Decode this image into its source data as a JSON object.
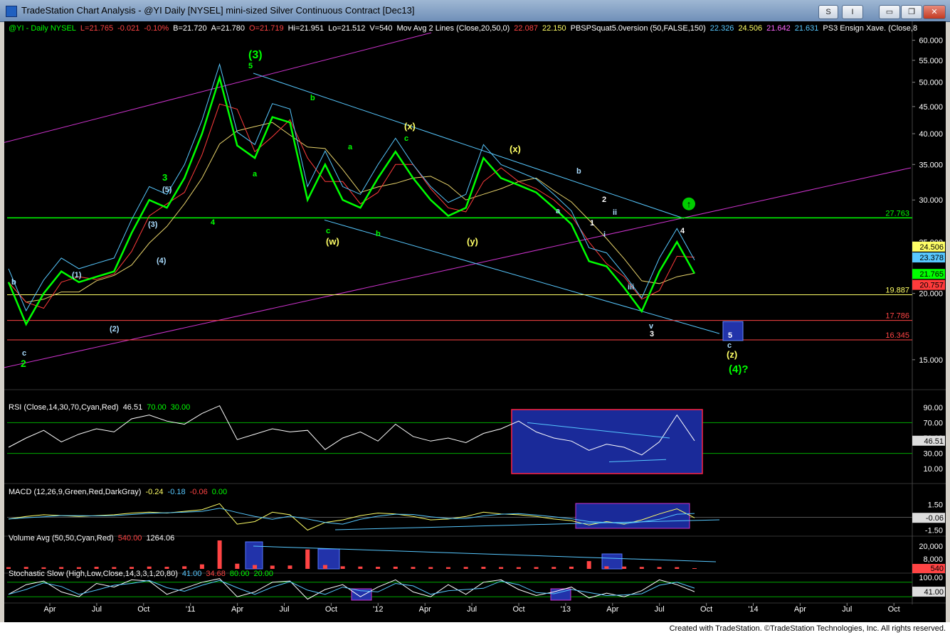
{
  "window": {
    "title": "TradeStation Chart Analysis - @YI Daily [NYSEL] mini-sized Silver Continuous Contract [Dec13]",
    "buttons": {
      "s_label": "S",
      "i_label": "I",
      "minimize": "▭",
      "restore": "❐",
      "close": "✕"
    }
  },
  "footer": {
    "text": "Created with TradeStation. ©TradeStation Technologies, Inc. All rights reserved."
  },
  "colors": {
    "price_up": "#00ff00",
    "ma20": "#ff3b3b",
    "ma50": "#e6d26a",
    "channel": "#57c8ff",
    "magenta": "#cc33cc",
    "resistance": "#00ff00",
    "support_yellow": "#ffff66",
    "support_red": "#ff4444"
  },
  "panels": {
    "price": {
      "header": [
        {
          "text": "@YI - Daily  NYSEL",
          "color": "#00ff00"
        },
        {
          "text": "L=21.765",
          "color": "#ff4444"
        },
        {
          "text": "-0.021",
          "color": "#ff4444"
        },
        {
          "text": "-0.10%",
          "color": "#ff4444"
        },
        {
          "text": "B=21.720",
          "color": "#ffffff"
        },
        {
          "text": "A=21.780",
          "color": "#ffffff"
        },
        {
          "text": "O=21.719",
          "color": "#ff4444"
        },
        {
          "text": "Hi=21.951",
          "color": "#ffffff"
        },
        {
          "text": "Lo=21.512",
          "color": "#ffffff"
        },
        {
          "text": "V=540",
          "color": "#ffffff"
        },
        {
          "text": "Mov Avg 2 Lines (Close,20,50,0)",
          "color": "#ffffff"
        },
        {
          "text": "22.087",
          "color": "#ff4444"
        },
        {
          "text": "22.150",
          "color": "#ffff66"
        },
        {
          "text": "PBSPSquat5.0version (50,FALSE,150)",
          "color": "#ffffff"
        },
        {
          "text": "22.326",
          "color": "#57c8ff"
        },
        {
          "text": "24.506",
          "color": "#ffff66"
        },
        {
          "text": "21.642",
          "color": "#ff66ff"
        },
        {
          "text": "21.631",
          "color": "#57c8ff"
        },
        {
          "text": "PS3 Ensign Xave. (Close,8",
          "color": "#ffffff"
        }
      ]
    },
    "rsi": {
      "header": [
        {
          "text": "RSI (Close,14,30,70,Cyan,Red)",
          "color": "#ffffff"
        },
        {
          "text": "46.51",
          "color": "#ffffff"
        },
        {
          "text": "70.00",
          "color": "#00ff00"
        },
        {
          "text": "30.00",
          "color": "#00ff00"
        }
      ]
    },
    "macd": {
      "header": [
        {
          "text": "MACD (12,26,9,Green,Red,DarkGray)",
          "color": "#ffffff"
        },
        {
          "text": "-0.24",
          "color": "#ffff66"
        },
        {
          "text": "-0.18",
          "color": "#57c8ff"
        },
        {
          "text": "-0.06",
          "color": "#ff4444"
        },
        {
          "text": "0.00",
          "color": "#00ff00"
        }
      ]
    },
    "volume": {
      "header": [
        {
          "text": "Volume Avg (50,50,Cyan,Red)",
          "color": "#ffffff"
        },
        {
          "text": "540.00",
          "color": "#ff4444"
        },
        {
          "text": "1264.06",
          "color": "#ffffff"
        }
      ]
    },
    "stoch": {
      "header": [
        {
          "text": "Stochastic Slow (High,Low,Close,14,3,3,1,20,80)",
          "color": "#ffffff"
        },
        {
          "text": "41.00",
          "color": "#57c8ff"
        },
        {
          "text": "34.68",
          "color": "#ff4444"
        },
        {
          "text": "80.00",
          "color": "#00ff00"
        },
        {
          "text": "20.00",
          "color": "#00ff00"
        }
      ]
    }
  },
  "chart_data": [
    {
      "type": "line",
      "x_tick_labels": [
        "Apr",
        "Jul",
        "Oct",
        "'11",
        "Apr",
        "Jul",
        "Oct",
        "'12",
        "Apr",
        "Jul",
        "Oct",
        "'13",
        "Apr",
        "Jul",
        "Oct",
        "'14",
        "Apr",
        "Jul",
        "Oct"
      ],
      "ylim": [
        13.5,
        62
      ],
      "y_scale": "log",
      "y_ticks": [
        "60.000",
        "55.000",
        "50.000",
        "45.000",
        "40.000",
        "35.000",
        "30.000",
        "25.000",
        "20.000",
        "15.000"
      ],
      "series": [
        {
          "values": [
            21.0,
            17.5,
            20.0,
            22.0,
            21.0,
            21.5,
            22.0,
            26.0,
            30.0,
            29.0,
            33.0,
            40.0,
            51.0,
            38.0,
            36.0,
            43.0,
            42.0,
            30.0,
            35.0,
            30.0,
            29.0,
            33.0,
            37.0,
            33.0,
            30.0,
            28.0,
            29.0,
            36.0,
            33.0,
            32.0,
            31.0,
            29.0,
            27.0,
            23.0,
            22.5,
            20.5,
            18.5,
            22.0,
            25.0,
            21.8
          ]
        }
      ],
      "horizontal_levels": [
        {
          "value": 27.763,
          "label": "27.763"
        },
        {
          "value": 19.887,
          "label": "19.887"
        },
        {
          "value": 17.786,
          "label": "17.786"
        },
        {
          "value": 16.345,
          "label": "16.345"
        }
      ],
      "right_badges": [
        {
          "label": "24.506"
        },
        {
          "label": "23.378"
        },
        {
          "label": "21.765"
        },
        {
          "label": "20.757"
        }
      ],
      "wave_labels": [
        {
          "text": "(3)",
          "color": "#00ff00"
        },
        {
          "text": "5",
          "color": "#00ff00"
        },
        {
          "text": "3",
          "color": "#00ff00"
        },
        {
          "text": "(5)",
          "color": "#aaddff"
        },
        {
          "text": "(3)",
          "color": "#aaddff"
        },
        {
          "text": "(4)",
          "color": "#aaddff"
        },
        {
          "text": "4",
          "color": "#00ff00"
        },
        {
          "text": "(1)",
          "color": "#aaddff"
        },
        {
          "text": "(2)",
          "color": "#aaddff"
        },
        {
          "text": "b",
          "color": "#aaddff"
        },
        {
          "text": "c",
          "color": "#aaddff"
        },
        {
          "text": "2",
          "color": "#00ff00"
        },
        {
          "text": "a",
          "color": "#00ff00"
        },
        {
          "text": "b",
          "color": "#00ff00"
        },
        {
          "text": "a",
          "color": "#00ff00"
        },
        {
          "text": "c",
          "color": "#00ff00"
        },
        {
          "text": "(w)",
          "color": "#ffff66"
        },
        {
          "text": "b",
          "color": "#00ff00"
        },
        {
          "text": "(x)",
          "color": "#ffff66"
        },
        {
          "text": "c",
          "color": "#00ff00"
        },
        {
          "text": "(y)",
          "color": "#ffff66"
        },
        {
          "text": "(x)",
          "color": "#ffff66"
        },
        {
          "text": "b",
          "color": "#aaddff"
        },
        {
          "text": "a",
          "color": "#aaddff"
        },
        {
          "text": "1",
          "color": "#ffffff"
        },
        {
          "text": "2",
          "color": "#ffffff"
        },
        {
          "text": "i",
          "color": "#aaddff"
        },
        {
          "text": "ii",
          "color": "#aaddff"
        },
        {
          "text": "iii",
          "color": "#aaddff"
        },
        {
          "text": "4",
          "color": "#ffffff"
        },
        {
          "text": "v",
          "color": "#aaddff"
        },
        {
          "text": "3",
          "color": "#ffffff"
        },
        {
          "text": "5",
          "color": "#ffffff"
        },
        {
          "text": "c",
          "color": "#aaddff"
        },
        {
          "text": "(z)",
          "color": "#ffff66"
        },
        {
          "text": "(4)?",
          "color": "#00ff00"
        }
      ]
    },
    {
      "type": "line",
      "ylim": [
        0,
        100
      ],
      "y_ticks": [
        "90.00",
        "70.00",
        "50.00",
        "30.00",
        "10.00"
      ],
      "levels": [
        70,
        30
      ],
      "series": [
        {
          "values": [
            38,
            50,
            60,
            45,
            55,
            62,
            58,
            75,
            80,
            72,
            68,
            82,
            92,
            48,
            55,
            62,
            58,
            60,
            35,
            50,
            58,
            46,
            68,
            52,
            46,
            50,
            44,
            56,
            62,
            72,
            58,
            50,
            46,
            34,
            42,
            38,
            28,
            45,
            80,
            46.51
          ]
        }
      ]
    },
    {
      "type": "line",
      "y_ticks": [
        "1.50",
        "-1.50"
      ],
      "series": [
        {
          "values": [
            -0.2,
            0.1,
            0.3,
            0.2,
            0.1,
            0.2,
            0.3,
            0.5,
            0.6,
            0.5,
            0.7,
            0.9,
            1.6,
            -0.8,
            -0.5,
            0.6,
            0.3,
            -1.5,
            -0.6,
            -0.3,
            0.2,
            0.5,
            0.4,
            0.1,
            -0.3,
            -0.2,
            0.1,
            0.6,
            0.4,
            0.3,
            0.1,
            -0.2,
            -0.4,
            -0.9,
            -0.5,
            -0.8,
            -0.3,
            0.4,
            1.0,
            -0.06
          ]
        }
      ]
    },
    {
      "type": "bar",
      "y_ticks": [
        "20,000",
        "8,000"
      ],
      "series": [
        {
          "values": [
            1300,
            1500,
            1200,
            1400,
            1300,
            1600,
            1400,
            1500,
            1800,
            1600,
            2000,
            3500,
            22000,
            4000,
            3000,
            2500,
            2600,
            15000,
            3000,
            2000,
            1800,
            1600,
            1700,
            1500,
            1400,
            1300,
            1500,
            1600,
            1400,
            1300,
            1400,
            1500,
            1700,
            6000,
            2000,
            1800,
            1500,
            1400,
            1300,
            540
          ]
        }
      ]
    },
    {
      "type": "line",
      "y_ticks": [
        "100.00"
      ],
      "levels": [
        80,
        20
      ],
      "series": [
        {
          "values": [
            30,
            70,
            85,
            40,
            20,
            75,
            60,
            90,
            85,
            30,
            55,
            80,
            95,
            20,
            40,
            80,
            85,
            10,
            50,
            70,
            20,
            60,
            90,
            40,
            20,
            70,
            30,
            80,
            90,
            50,
            25,
            40,
            60,
            15,
            35,
            20,
            45,
            90,
            70,
            41
          ]
        }
      ]
    }
  ],
  "right_axis_badges_lower": {
    "rsi": "46.51",
    "macd": "-0.06",
    "vol": "540",
    "stoch": "41.00"
  }
}
